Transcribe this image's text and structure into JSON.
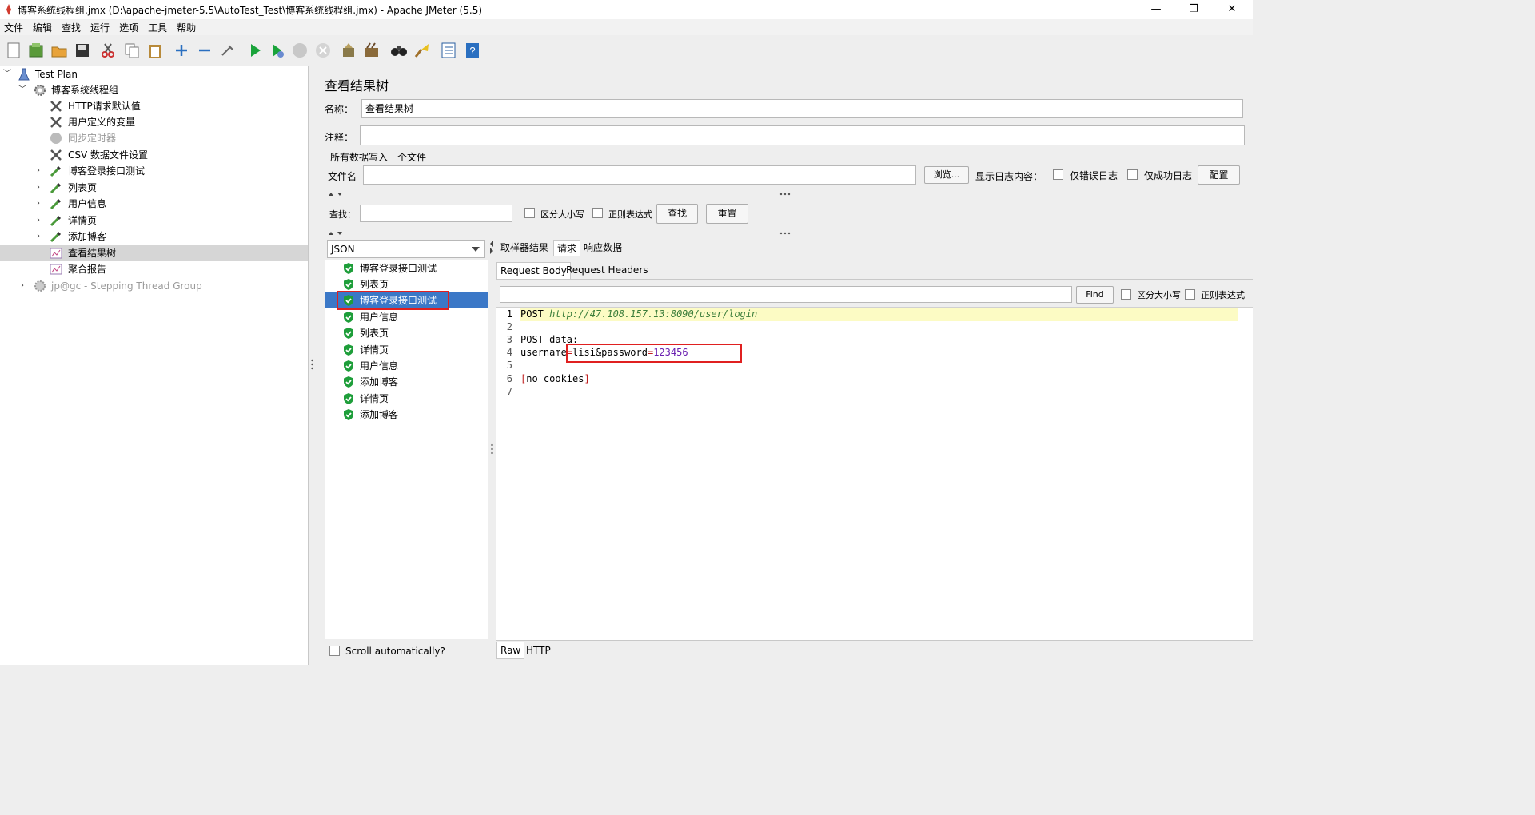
{
  "window": {
    "title": "博客系统线程组.jmx (D:\\apache-jmeter-5.5\\AutoTest_Test\\博客系统线程组.jmx) - Apache JMeter (5.5)",
    "minimize": "—",
    "maximize": "❐",
    "close": "✕"
  },
  "menu": [
    "文件",
    "编辑",
    "查找",
    "运行",
    "选项",
    "工具",
    "帮助"
  ],
  "tree": {
    "root": "Test Plan",
    "thread_group": "博客系统线程组",
    "items": [
      {
        "label": "HTTP请求默认值"
      },
      {
        "label": "用户定义的变量"
      },
      {
        "label": "同步定时器"
      },
      {
        "label": "CSV 数据文件设置"
      },
      {
        "label": "博客登录接口测试"
      },
      {
        "label": "列表页"
      },
      {
        "label": "用户信息"
      },
      {
        "label": "详情页"
      },
      {
        "label": "添加博客"
      },
      {
        "label": "查看结果树"
      },
      {
        "label": "聚合报告"
      }
    ],
    "stepping": "jp@gc - Stepping Thread Group"
  },
  "panel": {
    "title": "查看结果树",
    "name_label": "名称：",
    "name_value": "查看结果树",
    "comment_label": "注释：",
    "comment_value": "",
    "file_section": "所有数据写入一个文件",
    "filename_label": "文件名",
    "filename_value": "",
    "browse": "浏览...",
    "log_label": "显示日志内容：",
    "errors_only": "仅错误日志",
    "success_only": "仅成功日志",
    "configure": "配置",
    "search_label": "查找：",
    "search_value": "",
    "case_sensitive": "区分大小写",
    "regex": "正则表达式",
    "find_btn": "查找",
    "reset_btn": "重置"
  },
  "renderer": {
    "selected": "JSON",
    "results": [
      "博客登录接口测试",
      "列表页",
      "博客登录接口测试",
      "用户信息",
      "列表页",
      "详情页",
      "用户信息",
      "添加博客",
      "详情页",
      "添加博客"
    ],
    "scroll_auto": "Scroll automatically?"
  },
  "detail": {
    "tabs": [
      "取样器结果",
      "请求",
      "响应数据"
    ],
    "active_tab": "请求",
    "sub_tabs": [
      "Request Body",
      "Request Headers"
    ],
    "find_value": "",
    "find_btn": "Find",
    "case_sensitive": "区分大小写",
    "regex": "正则表达式",
    "lines": {
      "l1_method": "POST ",
      "l1_url": "http://47.108.157.13:8090/user/login",
      "l3": "POST data:",
      "l4_key1": "username",
      "l4_eq1": "=",
      "l4_val1": "lisi",
      "l4_amp": "&",
      "l4_key2": "password",
      "l4_eq2": "=",
      "l4_val2": "123456",
      "l6_open": "[",
      "l6_text": "no cookies",
      "l6_close": "]"
    },
    "line_numbers": [
      "1",
      "2",
      "3",
      "4",
      "5",
      "6",
      "7"
    ],
    "bottom_tabs": [
      "Raw",
      "HTTP"
    ]
  },
  "colors": {
    "selection_blue": "#3b78c7",
    "highlight_red": "#e02020",
    "line_highlight": "#fcfbc4",
    "url_green": "#3a7d3a",
    "value_purple": "#6a1fb0"
  }
}
